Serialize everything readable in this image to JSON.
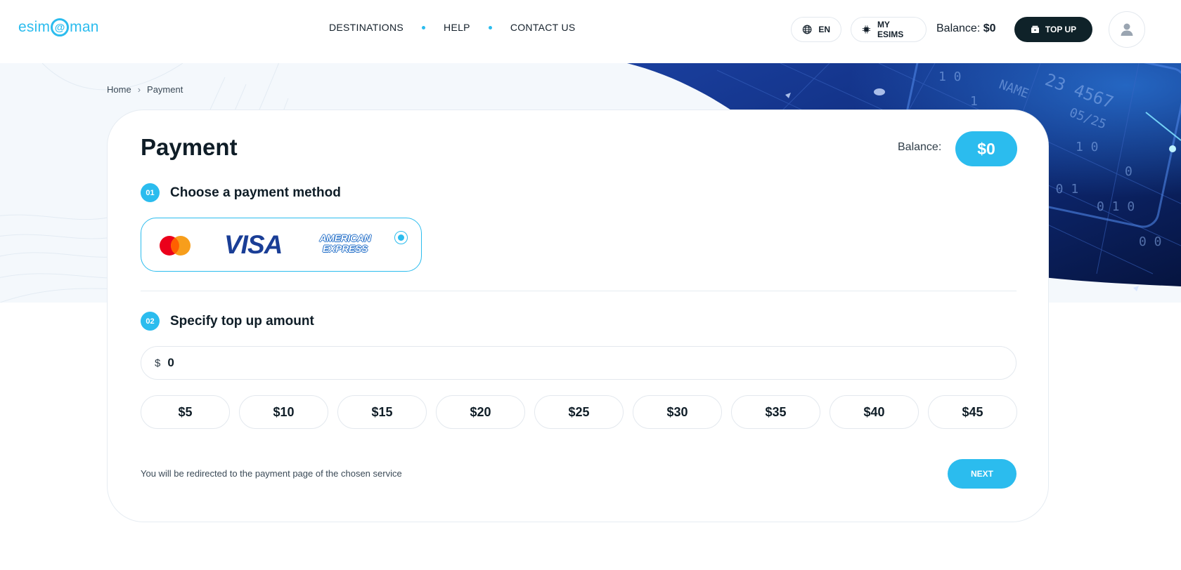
{
  "header": {
    "logo_left": "esim",
    "logo_at": "@",
    "logo_right": "man",
    "nav": [
      "DESTINATIONS",
      "HELP",
      "CONTACT US"
    ],
    "lang_label": "EN",
    "esims_label": "MY ESIMS",
    "balance_label": "Balance:",
    "balance_value": "$0",
    "topup_label": "TOP UP"
  },
  "breadcrumb": {
    "home": "Home",
    "current": "Payment"
  },
  "payment": {
    "title": "Payment",
    "balance_label": "Balance:",
    "balance_value": "$0",
    "step1": {
      "num": "01",
      "label": "Choose a payment method"
    },
    "method": {
      "visa": "VISA",
      "amex_line1": "AMERICAN",
      "amex_line2": "EXPRESS",
      "selected": true
    },
    "step2": {
      "num": "02",
      "label": "Specify top up amount"
    },
    "amount": {
      "currency": "$",
      "value": "0"
    },
    "presets": [
      "$5",
      "$10",
      "$15",
      "$20",
      "$25",
      "$30",
      "$35",
      "$40",
      "$45"
    ],
    "note": "You will be redirected to the payment page of the chosen service",
    "next_label": "NEXT"
  },
  "colors": {
    "accent": "#2bbcee",
    "dark": "#0f2229",
    "navy": "#0e2f7a"
  }
}
